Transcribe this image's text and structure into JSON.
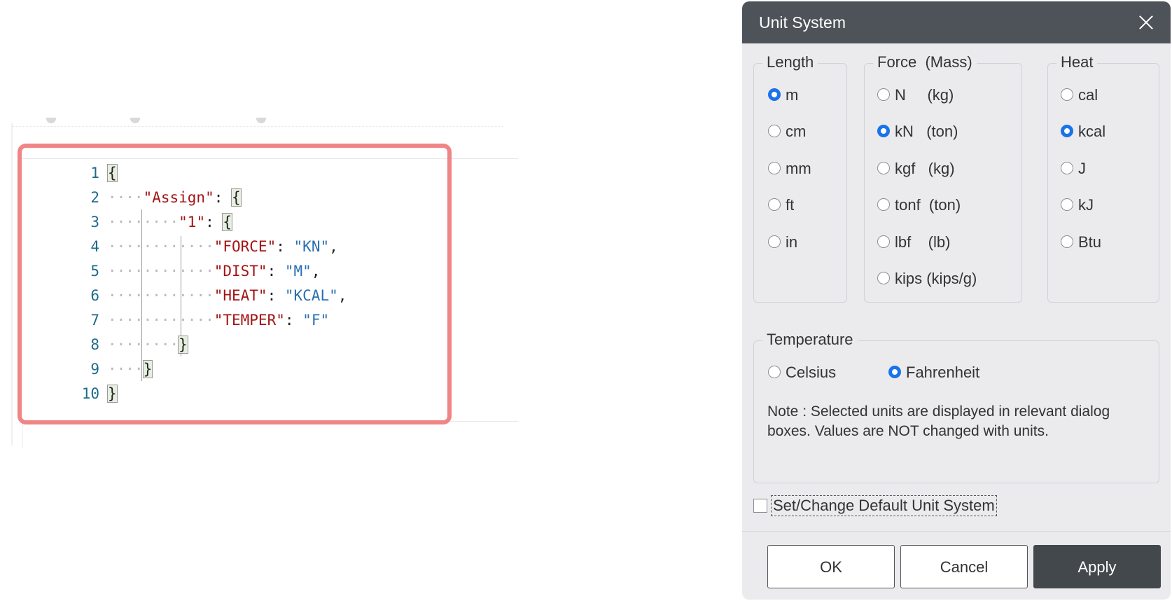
{
  "editor": {
    "lines": [
      {
        "no": "1"
      },
      {
        "no": "2",
        "key": "\"Assign\"",
        "sep": ": "
      },
      {
        "no": "3",
        "key": "\"1\"",
        "sep": ": "
      },
      {
        "no": "4",
        "key": "\"FORCE\"",
        "sep": ": ",
        "value": "\"KN\"",
        "end": ","
      },
      {
        "no": "5",
        "key": "\"DIST\"",
        "sep": ": ",
        "value": "\"M\"",
        "end": ","
      },
      {
        "no": "6",
        "key": "\"HEAT\"",
        "sep": ": ",
        "value": "\"KCAL\"",
        "end": ","
      },
      {
        "no": "7",
        "key": "\"TEMPER\"",
        "sep": ": ",
        "value": "\"F\""
      },
      {
        "no": "8"
      },
      {
        "no": "9"
      },
      {
        "no": "10"
      }
    ],
    "open_brace": "{",
    "close_brace": "}"
  },
  "dialog": {
    "title": "Unit System",
    "close_icon": "close-icon",
    "length": {
      "legend": "Length",
      "options": [
        "m",
        "cm",
        "mm",
        "ft",
        "in"
      ],
      "selected": "m"
    },
    "force": {
      "legend": "Force  (Mass)",
      "options": [
        "N     (kg)",
        "kN   (ton)",
        "kgf   (kg)",
        "tonf  (ton)",
        "lbf    (lb)",
        "kips (kips/g)"
      ],
      "selected": "kN   (ton)"
    },
    "heat": {
      "legend": "Heat",
      "options": [
        "cal",
        "kcal",
        "J",
        "kJ",
        "Btu"
      ],
      "selected": "kcal"
    },
    "temperature": {
      "legend": "Temperature",
      "options": [
        "Celsius",
        "Fahrenheit"
      ],
      "selected": "Fahrenheit"
    },
    "note": "Note : Selected units are displayed in relevant dialog boxes. Values are NOT changed with units.",
    "default_checkbox": {
      "label": "Set/Change Default Unit System",
      "checked": false
    },
    "buttons": {
      "ok": "OK",
      "cancel": "Cancel",
      "apply": "Apply"
    },
    "colors": {
      "accent": "#1a73e8",
      "titlebar": "#4d5358",
      "highlight_border": "#f08585"
    }
  }
}
